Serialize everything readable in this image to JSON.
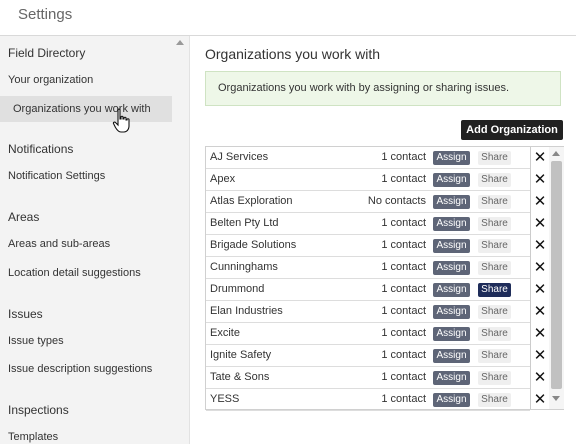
{
  "header": {
    "title": "Settings"
  },
  "sidebar": {
    "sections": [
      {
        "heading": "Field Directory",
        "items": [
          "Your organization",
          "Organizations you work with"
        ]
      },
      {
        "heading": "Notifications",
        "items": [
          "Notification Settings"
        ]
      },
      {
        "heading": "Areas",
        "items": [
          "Areas and sub-areas",
          "Location detail suggestions"
        ]
      },
      {
        "heading": "Issues",
        "items": [
          "Issue types",
          "Issue description suggestions"
        ]
      },
      {
        "heading": "Inspections",
        "items": [
          "Templates"
        ]
      }
    ],
    "active_item": "Organizations you work with"
  },
  "main": {
    "title": "Organizations you work with",
    "info": "Organizations you work with by assigning or sharing issues.",
    "add_button": "Add Organization",
    "assign_label": "Assign",
    "share_label": "Share",
    "remove_glyph": "✕",
    "organizations": [
      {
        "name": "AJ Services",
        "contacts": "1 contact",
        "shared": false
      },
      {
        "name": "Apex",
        "contacts": "1 contact",
        "shared": false
      },
      {
        "name": "Atlas Exploration",
        "contacts": "No contacts",
        "shared": false
      },
      {
        "name": "Belten Pty Ltd",
        "contacts": "1 contact",
        "shared": false
      },
      {
        "name": "Brigade Solutions",
        "contacts": "1 contact",
        "shared": false
      },
      {
        "name": "Cunninghams",
        "contacts": "1 contact",
        "shared": false
      },
      {
        "name": "Drummond",
        "contacts": "1 contact",
        "shared": true
      },
      {
        "name": "Elan Industries",
        "contacts": "1 contact",
        "shared": false
      },
      {
        "name": "Excite",
        "contacts": "1 contact",
        "shared": false
      },
      {
        "name": "Ignite Safety",
        "contacts": "1 contact",
        "shared": false
      },
      {
        "name": "Tate & Sons",
        "contacts": "1 contact",
        "shared": false
      },
      {
        "name": "YESS",
        "contacts": "1 contact",
        "shared": false
      }
    ]
  },
  "colors": {
    "assign_bg": "#5e6577",
    "share_active_bg": "#1f2d5a",
    "info_bg": "#eef7e8",
    "add_button_bg": "#212121"
  }
}
